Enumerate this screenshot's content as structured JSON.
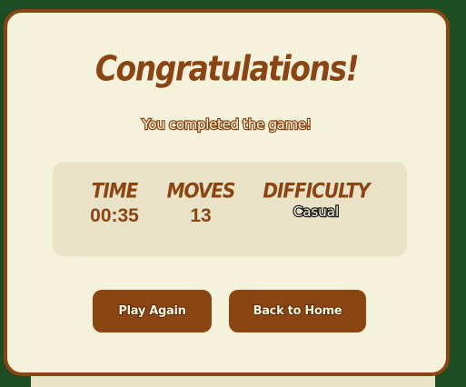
{
  "modal": {
    "title": "Congratulations!",
    "subtitle": "You completed the game!"
  },
  "stats": {
    "time": {
      "label": "Time",
      "value": "00:35"
    },
    "moves": {
      "label": "Moves",
      "value": "13"
    },
    "difficulty": {
      "label": "Difficulty",
      "value": "Casual"
    }
  },
  "buttons": {
    "play_again": "Play Again",
    "back_to_home": "Back to Home"
  },
  "colors": {
    "background": "#1e4d23",
    "modal_bg": "#f5f2dc",
    "accent": "#8b4513",
    "stats_bg": "#e9e2c6"
  }
}
